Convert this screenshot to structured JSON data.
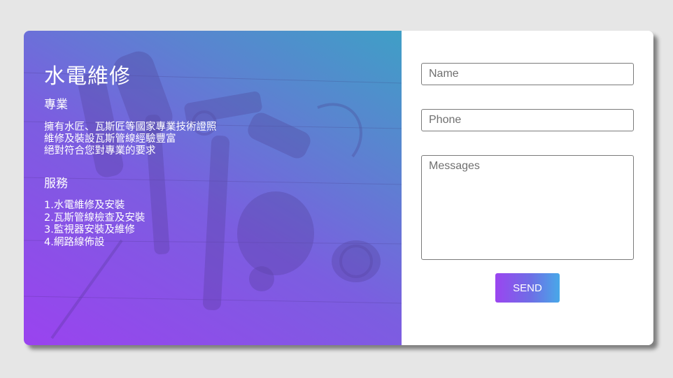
{
  "hero": {
    "title": "水電維修",
    "professional_heading": "專業",
    "professional_lines": [
      "擁有水匠、瓦斯匠等國家專業技術證照",
      "維修及裝設瓦斯管線經驗豐富",
      "絕對符合您對專業的要求"
    ],
    "services_heading": "服務",
    "services": [
      "1.水電維修及安裝",
      "2.瓦斯管線檢查及安裝",
      "3.監視器安裝及維修",
      "4.網路線佈設"
    ]
  },
  "form": {
    "name_placeholder": "Name",
    "phone_placeholder": "Phone",
    "message_placeholder": "Messages",
    "send_label": "SEND"
  },
  "colors": {
    "gradient_start": "#9a43ef",
    "gradient_end": "#3f9fc6",
    "page_background": "#e6e6e6"
  }
}
